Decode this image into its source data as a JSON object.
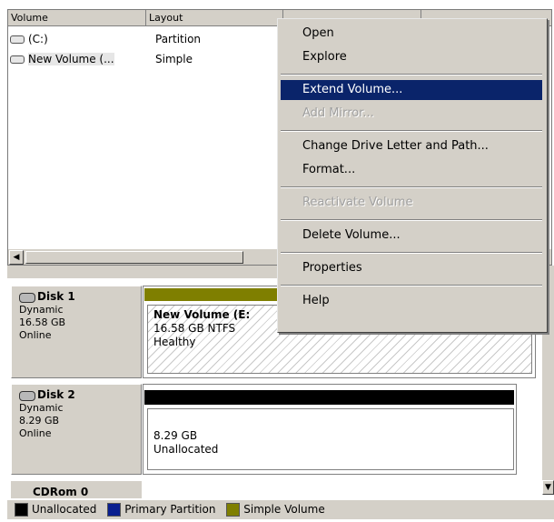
{
  "volume_list": {
    "columns": [
      "Volume",
      "Layout",
      "",
      ""
    ],
    "rows": [
      {
        "volume": "(C:)",
        "layout": "Partition"
      },
      {
        "volume": "New Volume (...",
        "layout": "Simple"
      }
    ]
  },
  "disks": [
    {
      "name": "Disk 1",
      "type": "Dynamic",
      "size": "16.58 GB",
      "status": "Online",
      "partition": {
        "label": "New Volume  (E:",
        "detail": "16.58 GB NTFS",
        "state": "Healthy"
      }
    },
    {
      "name": "Disk 2",
      "type": "Dynamic",
      "size": "8.29 GB",
      "status": "Online",
      "partition": {
        "label": "",
        "detail": "8.29 GB",
        "state": "Unallocated"
      }
    },
    {
      "name": "CDRom 0"
    }
  ],
  "context_menu": {
    "groups": [
      [
        {
          "label": "Open",
          "enabled": true
        },
        {
          "label": "Explore",
          "enabled": true
        }
      ],
      [
        {
          "label": "Extend Volume...",
          "enabled": true,
          "highlighted": true
        },
        {
          "label": "Add Mirror...",
          "enabled": false
        }
      ],
      [
        {
          "label": "Change Drive Letter and Path...",
          "enabled": true
        },
        {
          "label": "Format...",
          "enabled": true
        }
      ],
      [
        {
          "label": "Reactivate Volume",
          "enabled": false
        }
      ],
      [
        {
          "label": "Delete Volume...",
          "enabled": true
        }
      ],
      [
        {
          "label": "Properties",
          "enabled": true
        }
      ],
      [
        {
          "label": "Help",
          "enabled": true
        }
      ]
    ]
  },
  "legend": [
    {
      "label": "Unallocated",
      "color": "#000000"
    },
    {
      "label": "Primary Partition",
      "color": "#0a1f8f"
    },
    {
      "label": "Simple Volume",
      "color": "#7f7f00"
    }
  ]
}
